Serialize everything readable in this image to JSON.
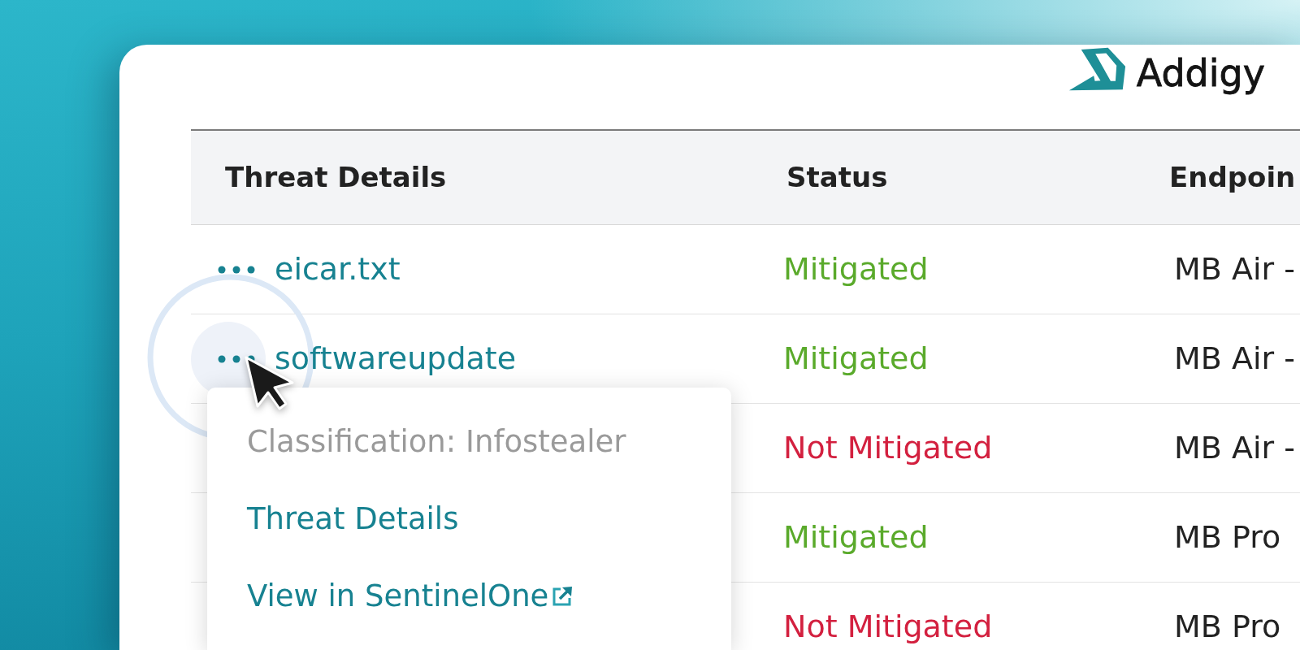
{
  "logo": {
    "text": "Addigy"
  },
  "table": {
    "columns": [
      "Threat Details",
      "Status",
      "Endpoin"
    ],
    "rows": [
      {
        "threat": "eicar.txt",
        "status": {
          "text": "Mitigated",
          "color": "#5aaa2b"
        },
        "endpoint": "MB Air -"
      },
      {
        "threat": "softwareupdate",
        "status": {
          "text": "Mitigated",
          "color": "#5aaa2b"
        },
        "endpoint": "MB Air -"
      },
      {
        "status": {
          "text": "Not Mitigated",
          "color": "#d3203f"
        },
        "endpoint": "MB Air -"
      },
      {
        "status": {
          "text": "Mitigated",
          "color": "#5aaa2b"
        },
        "endpoint": "MB Pro"
      },
      {
        "status": {
          "text": "Not Mitigated",
          "color": "#d3203f"
        },
        "endpoint": "MB Pro"
      }
    ]
  },
  "context_menu": {
    "items": [
      {
        "kind": "label",
        "text": "Classification: Infostealer"
      },
      {
        "kind": "link",
        "text": "Threat Details"
      },
      {
        "kind": "external_link",
        "text": "View in SentinelOne"
      }
    ]
  }
}
